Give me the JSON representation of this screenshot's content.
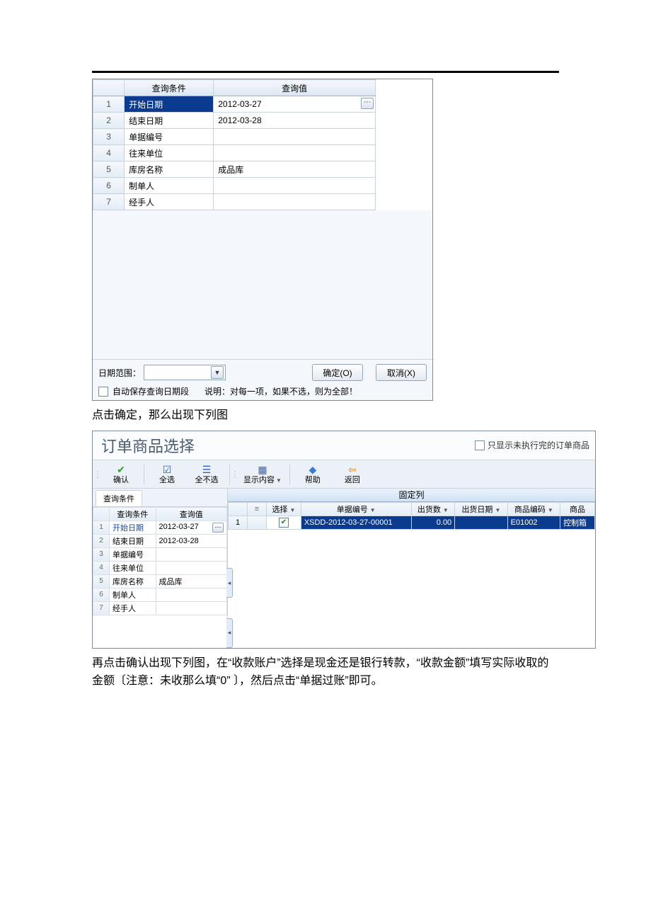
{
  "dialog1": {
    "headers": {
      "cond": "查询条件",
      "val": "查询值"
    },
    "rows": [
      {
        "n": "1",
        "cond": "开始日期",
        "val": "2012-03-27",
        "sel": true,
        "picker": true
      },
      {
        "n": "2",
        "cond": "结束日期",
        "val": "2012-03-28"
      },
      {
        "n": "3",
        "cond": "单据编号",
        "val": ""
      },
      {
        "n": "4",
        "cond": "往来单位",
        "val": ""
      },
      {
        "n": "5",
        "cond": "库房名称",
        "val": "成品库"
      },
      {
        "n": "6",
        "cond": "制单人",
        "val": ""
      },
      {
        "n": "7",
        "cond": "经手人",
        "val": ""
      }
    ],
    "range_label": "日期范围：",
    "ok": "确定(O)",
    "cancel": "取消(X)",
    "autosave": "自动保存查询日期段",
    "note": "说明：对每一项，如果不选，则为全部！"
  },
  "text1": "点击确定，那么出现下列图",
  "dialog2": {
    "title": "订单商品选择",
    "only_unfinished": "只显示未执行完的订单商品",
    "toolbar": {
      "confirm": "确认",
      "select_all": "全选",
      "select_none": "全不选",
      "display": "显示内容",
      "help": "帮助",
      "back": "返回"
    },
    "left": {
      "tab": "查询条件",
      "headers": {
        "cond": "查询条件",
        "val": "查询值"
      },
      "rows": [
        {
          "n": "1",
          "cond": "开始日期",
          "val": "2012-03-27",
          "sel": true,
          "picker": true
        },
        {
          "n": "2",
          "cond": "结束日期",
          "val": "2012-03-28"
        },
        {
          "n": "3",
          "cond": "单据编号",
          "val": ""
        },
        {
          "n": "4",
          "cond": "往来单位",
          "val": ""
        },
        {
          "n": "5",
          "cond": "库房名称",
          "val": "成品库"
        },
        {
          "n": "6",
          "cond": "制单人",
          "val": ""
        },
        {
          "n": "7",
          "cond": "经手人",
          "val": ""
        }
      ]
    },
    "right": {
      "fixed_label": "固定列",
      "headers": {
        "select": "选择",
        "docno": "单据编号",
        "ship_qty": "出货数",
        "ship_date": "出货日期",
        "item_code": "商品编码",
        "item": "商品"
      },
      "rows": [
        {
          "n": "1",
          "checked": true,
          "docno": "XSDD-2012-03-27-00001",
          "ship_qty": "0.00",
          "ship_date": "",
          "item_code": "E01002",
          "item": "控制箱"
        }
      ]
    }
  },
  "text2": "再点击确认出现下列图，在“收款账户”选择是现金还是银行转款，“收款金额”填写实际收取的金额〔注意：未收那么填“0” 〕，然后点击“单据过账”即可。"
}
